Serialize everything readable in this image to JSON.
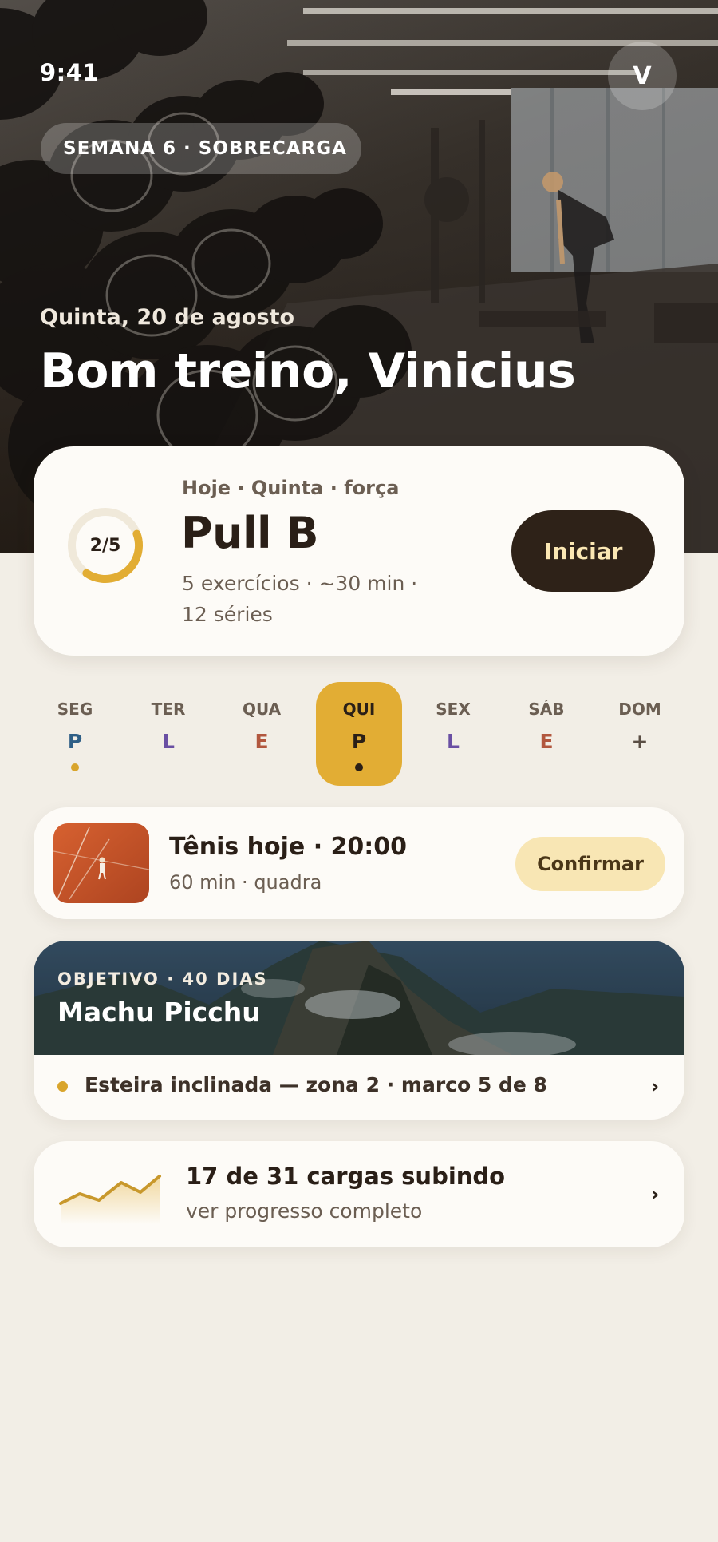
{
  "status": {
    "time": "9:41"
  },
  "hero": {
    "avatar_initial": "V",
    "week_badge": "SEMANA 6 · SOBRECARGA",
    "date": "Quinta, 20 de agosto",
    "greeting": "Bom treino, Vinicius"
  },
  "workout": {
    "progress_label": "2/5",
    "progress_fraction": 0.4,
    "eyebrow": "Hoje · Quinta · força",
    "title": "Pull B",
    "meta": "5 exercícios · ~30 min · 12 séries",
    "start_label": "Iniciar"
  },
  "week": {
    "days": [
      {
        "name": "SEG",
        "code": "P",
        "color": "#2f5f86",
        "dot": true,
        "dot_color": "#d9a52c",
        "active": false
      },
      {
        "name": "TER",
        "code": "L",
        "color": "#6a4fa3",
        "dot": false,
        "active": false
      },
      {
        "name": "QUA",
        "code": "E",
        "color": "#b2573e",
        "dot": false,
        "active": false
      },
      {
        "name": "QUI",
        "code": "P",
        "color": "#2a1f17",
        "dot": true,
        "dot_color": "#2a1f17",
        "active": true
      },
      {
        "name": "SEX",
        "code": "L",
        "color": "#6a4fa3",
        "dot": false,
        "active": false
      },
      {
        "name": "SÁB",
        "code": "E",
        "color": "#b2573e",
        "dot": false,
        "active": false
      },
      {
        "name": "DOM",
        "code": "+",
        "color": "#5a4e44",
        "dot": false,
        "active": false
      }
    ]
  },
  "tennis": {
    "title": "Tênis hoje · 20:00",
    "subtitle": "60 min · quadra",
    "confirm_label": "Confirmar"
  },
  "goal": {
    "eyebrow": "OBJETIVO · 40 DIAS",
    "title": "Machu Picchu",
    "milestone": "Esteira inclinada — zona 2 · marco 5 de 8"
  },
  "progress": {
    "title": "17 de 31 cargas subindo",
    "subtitle": "ver progresso completo"
  },
  "colors": {
    "accent": "#e2ad34",
    "dark": "#2e2218",
    "background": "#f2eee6",
    "card": "#fdfbf7"
  }
}
